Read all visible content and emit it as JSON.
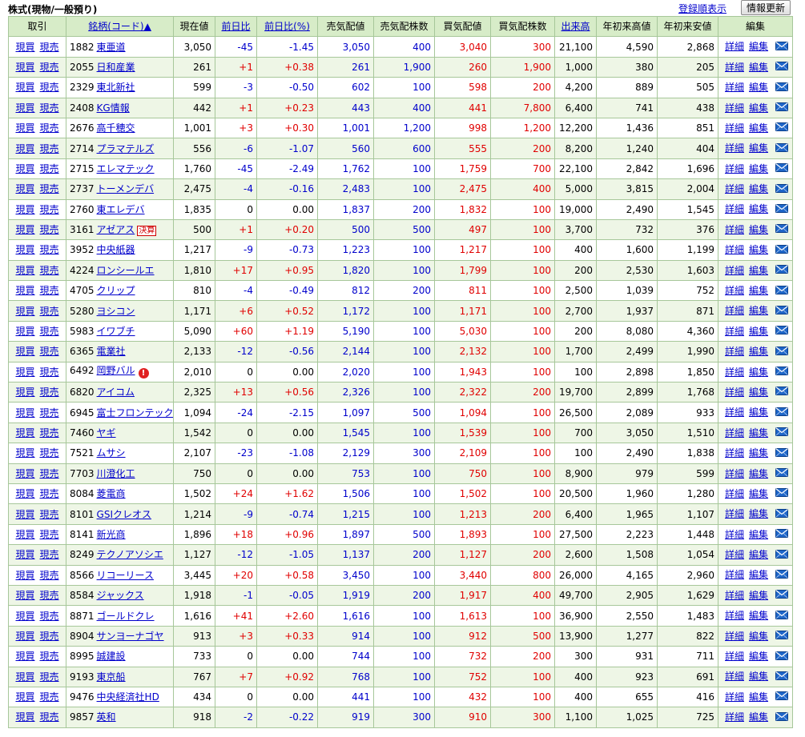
{
  "header": {
    "section_title": "株式(現物/一般預り)",
    "sort_link": "登録順表示",
    "refresh_button": "情報更新"
  },
  "columns": {
    "trade": "取引",
    "symbol": "銘柄(コード)▲",
    "price": "現在値",
    "change": "前日比",
    "change_pct": "前日比(%)",
    "ask": "売気配値",
    "ask_qty": "売気配株数",
    "bid": "買気配値",
    "bid_qty": "買気配株数",
    "volume": "出来高",
    "ytd_high": "年初来高値",
    "ytd_low": "年初来安値",
    "edit": "編集"
  },
  "labels": {
    "buy": "現買",
    "sell": "現売",
    "detail": "詳細",
    "edit": "編集",
    "kessan_badge": "決算",
    "alert_badge": "!"
  },
  "colors": {
    "header_bg": "#d7ecc8",
    "row_alt_bg": "#eef6e6",
    "border": "#a7c79a",
    "link": "#0000cc",
    "up": "#e00000"
  },
  "rows": [
    {
      "code": "1882",
      "name": "東亜道",
      "price": "3,050",
      "change": "-45",
      "pct": "-1.45",
      "ask": "3,050",
      "ask_qty": "400",
      "bid": "3,040",
      "bid_qty": "300",
      "volume": "21,100",
      "high": "4,590",
      "low": "2,868"
    },
    {
      "code": "2055",
      "name": "日和産業",
      "price": "261",
      "change": "+1",
      "pct": "+0.38",
      "ask": "261",
      "ask_qty": "1,900",
      "bid": "260",
      "bid_qty": "1,900",
      "volume": "1,000",
      "high": "380",
      "low": "205"
    },
    {
      "code": "2329",
      "name": "東北新社",
      "price": "599",
      "change": "-3",
      "pct": "-0.50",
      "ask": "602",
      "ask_qty": "100",
      "bid": "598",
      "bid_qty": "200",
      "volume": "4,200",
      "high": "889",
      "low": "505"
    },
    {
      "code": "2408",
      "name": "KG情報",
      "price": "442",
      "change": "+1",
      "pct": "+0.23",
      "ask": "443",
      "ask_qty": "400",
      "bid": "441",
      "bid_qty": "7,800",
      "volume": "6,400",
      "high": "741",
      "low": "438"
    },
    {
      "code": "2676",
      "name": "高千穂交",
      "price": "1,001",
      "change": "+3",
      "pct": "+0.30",
      "ask": "1,001",
      "ask_qty": "1,200",
      "bid": "998",
      "bid_qty": "1,200",
      "volume": "12,200",
      "high": "1,436",
      "low": "851"
    },
    {
      "code": "2714",
      "name": "プラマテルズ",
      "price": "556",
      "change": "-6",
      "pct": "-1.07",
      "ask": "560",
      "ask_qty": "600",
      "bid": "555",
      "bid_qty": "200",
      "volume": "8,200",
      "high": "1,240",
      "low": "404"
    },
    {
      "code": "2715",
      "name": "エレマテック",
      "price": "1,760",
      "change": "-45",
      "pct": "-2.49",
      "ask": "1,762",
      "ask_qty": "100",
      "bid": "1,759",
      "bid_qty": "700",
      "volume": "22,100",
      "high": "2,842",
      "low": "1,696"
    },
    {
      "code": "2737",
      "name": "トーメンデバ",
      "price": "2,475",
      "change": "-4",
      "pct": "-0.16",
      "ask": "2,483",
      "ask_qty": "100",
      "bid": "2,475",
      "bid_qty": "400",
      "volume": "5,000",
      "high": "3,815",
      "low": "2,004"
    },
    {
      "code": "2760",
      "name": "東エレデバ",
      "price": "1,835",
      "change": "0",
      "pct": "0.00",
      "ask": "1,837",
      "ask_qty": "200",
      "bid": "1,832",
      "bid_qty": "100",
      "volume": "19,000",
      "high": "2,490",
      "low": "1,545"
    },
    {
      "code": "3161",
      "name": "アゼアス",
      "badge": "kessan",
      "price": "500",
      "change": "+1",
      "pct": "+0.20",
      "ask": "500",
      "ask_qty": "500",
      "bid": "497",
      "bid_qty": "100",
      "volume": "3,700",
      "high": "732",
      "low": "376"
    },
    {
      "code": "3952",
      "name": "中央紙器",
      "price": "1,217",
      "change": "-9",
      "pct": "-0.73",
      "ask": "1,223",
      "ask_qty": "100",
      "bid": "1,217",
      "bid_qty": "100",
      "volume": "400",
      "high": "1,600",
      "low": "1,199"
    },
    {
      "code": "4224",
      "name": "ロンシールエ",
      "price": "1,810",
      "change": "+17",
      "pct": "+0.95",
      "ask": "1,820",
      "ask_qty": "100",
      "bid": "1,799",
      "bid_qty": "100",
      "volume": "200",
      "high": "2,530",
      "low": "1,603"
    },
    {
      "code": "4705",
      "name": "クリップ",
      "price": "810",
      "change": "-4",
      "pct": "-0.49",
      "ask": "812",
      "ask_qty": "200",
      "bid": "811",
      "bid_qty": "100",
      "volume": "2,500",
      "high": "1,039",
      "low": "752"
    },
    {
      "code": "5280",
      "name": "ヨシコン",
      "price": "1,171",
      "change": "+6",
      "pct": "+0.52",
      "ask": "1,172",
      "ask_qty": "100",
      "bid": "1,171",
      "bid_qty": "100",
      "volume": "2,700",
      "high": "1,937",
      "low": "871"
    },
    {
      "code": "5983",
      "name": "イワブチ",
      "price": "5,090",
      "change": "+60",
      "pct": "+1.19",
      "ask": "5,190",
      "ask_qty": "100",
      "bid": "5,030",
      "bid_qty": "100",
      "volume": "200",
      "high": "8,080",
      "low": "4,360"
    },
    {
      "code": "6365",
      "name": "電業社",
      "price": "2,133",
      "change": "-12",
      "pct": "-0.56",
      "ask": "2,144",
      "ask_qty": "100",
      "bid": "2,132",
      "bid_qty": "100",
      "volume": "1,700",
      "high": "2,499",
      "low": "1,990"
    },
    {
      "code": "6492",
      "name": "岡野バル",
      "badge": "alert",
      "price": "2,010",
      "change": "0",
      "pct": "0.00",
      "ask": "2,020",
      "ask_qty": "100",
      "bid": "1,943",
      "bid_qty": "100",
      "volume": "100",
      "high": "2,898",
      "low": "1,850"
    },
    {
      "code": "6820",
      "name": "アイコム",
      "price": "2,325",
      "change": "+13",
      "pct": "+0.56",
      "ask": "2,326",
      "ask_qty": "100",
      "bid": "2,322",
      "bid_qty": "200",
      "volume": "19,700",
      "high": "2,899",
      "low": "1,768"
    },
    {
      "code": "6945",
      "name": "富士フロンテック",
      "price": "1,094",
      "change": "-24",
      "pct": "-2.15",
      "ask": "1,097",
      "ask_qty": "500",
      "bid": "1,094",
      "bid_qty": "100",
      "volume": "26,500",
      "high": "2,089",
      "low": "933"
    },
    {
      "code": "7460",
      "name": "ヤギ",
      "price": "1,542",
      "change": "0",
      "pct": "0.00",
      "ask": "1,545",
      "ask_qty": "100",
      "bid": "1,539",
      "bid_qty": "100",
      "volume": "700",
      "high": "3,050",
      "low": "1,510"
    },
    {
      "code": "7521",
      "name": "ムサシ",
      "price": "2,107",
      "change": "-23",
      "pct": "-1.08",
      "ask": "2,129",
      "ask_qty": "300",
      "bid": "2,109",
      "bid_qty": "100",
      "volume": "100",
      "high": "2,490",
      "low": "1,838"
    },
    {
      "code": "7703",
      "name": "川澄化工",
      "price": "750",
      "change": "0",
      "pct": "0.00",
      "ask": "753",
      "ask_qty": "100",
      "bid": "750",
      "bid_qty": "100",
      "volume": "8,900",
      "high": "979",
      "low": "599"
    },
    {
      "code": "8084",
      "name": "菱電商",
      "price": "1,502",
      "change": "+24",
      "pct": "+1.62",
      "ask": "1,506",
      "ask_qty": "100",
      "bid": "1,502",
      "bid_qty": "100",
      "volume": "20,500",
      "high": "1,960",
      "low": "1,280"
    },
    {
      "code": "8101",
      "name": "GSIクレオス",
      "price": "1,214",
      "change": "-9",
      "pct": "-0.74",
      "ask": "1,215",
      "ask_qty": "100",
      "bid": "1,213",
      "bid_qty": "200",
      "volume": "6,400",
      "high": "1,965",
      "low": "1,107"
    },
    {
      "code": "8141",
      "name": "新光商",
      "price": "1,896",
      "change": "+18",
      "pct": "+0.96",
      "ask": "1,897",
      "ask_qty": "500",
      "bid": "1,893",
      "bid_qty": "100",
      "volume": "27,500",
      "high": "2,223",
      "low": "1,448"
    },
    {
      "code": "8249",
      "name": "テクノアソシエ",
      "price": "1,127",
      "change": "-12",
      "pct": "-1.05",
      "ask": "1,137",
      "ask_qty": "200",
      "bid": "1,127",
      "bid_qty": "200",
      "volume": "2,600",
      "high": "1,508",
      "low": "1,054"
    },
    {
      "code": "8566",
      "name": "リコーリース",
      "price": "3,445",
      "change": "+20",
      "pct": "+0.58",
      "ask": "3,450",
      "ask_qty": "100",
      "bid": "3,440",
      "bid_qty": "800",
      "volume": "26,000",
      "high": "4,165",
      "low": "2,960"
    },
    {
      "code": "8584",
      "name": "ジャックス",
      "price": "1,918",
      "change": "-1",
      "pct": "-0.05",
      "ask": "1,919",
      "ask_qty": "200",
      "bid": "1,917",
      "bid_qty": "400",
      "volume": "49,700",
      "high": "2,905",
      "low": "1,629"
    },
    {
      "code": "8871",
      "name": "ゴールドクレ",
      "price": "1,616",
      "change": "+41",
      "pct": "+2.60",
      "ask": "1,616",
      "ask_qty": "100",
      "bid": "1,613",
      "bid_qty": "100",
      "volume": "36,900",
      "high": "2,550",
      "low": "1,483"
    },
    {
      "code": "8904",
      "name": "サンヨーナゴヤ",
      "price": "913",
      "change": "+3",
      "pct": "+0.33",
      "ask": "914",
      "ask_qty": "100",
      "bid": "912",
      "bid_qty": "500",
      "volume": "13,900",
      "high": "1,277",
      "low": "822"
    },
    {
      "code": "8995",
      "name": "誠建設",
      "price": "733",
      "change": "0",
      "pct": "0.00",
      "ask": "744",
      "ask_qty": "100",
      "bid": "732",
      "bid_qty": "200",
      "volume": "300",
      "high": "931",
      "low": "711"
    },
    {
      "code": "9193",
      "name": "東京船",
      "price": "767",
      "change": "+7",
      "pct": "+0.92",
      "ask": "768",
      "ask_qty": "100",
      "bid": "752",
      "bid_qty": "100",
      "volume": "400",
      "high": "923",
      "low": "691"
    },
    {
      "code": "9476",
      "name": "中央経済社HD",
      "price": "434",
      "change": "0",
      "pct": "0.00",
      "ask": "441",
      "ask_qty": "100",
      "bid": "432",
      "bid_qty": "100",
      "volume": "400",
      "high": "655",
      "low": "416"
    },
    {
      "code": "9857",
      "name": "英和",
      "price": "918",
      "change": "-2",
      "pct": "-0.22",
      "ask": "919",
      "ask_qty": "300",
      "bid": "910",
      "bid_qty": "300",
      "volume": "1,100",
      "high": "1,025",
      "low": "725"
    }
  ]
}
